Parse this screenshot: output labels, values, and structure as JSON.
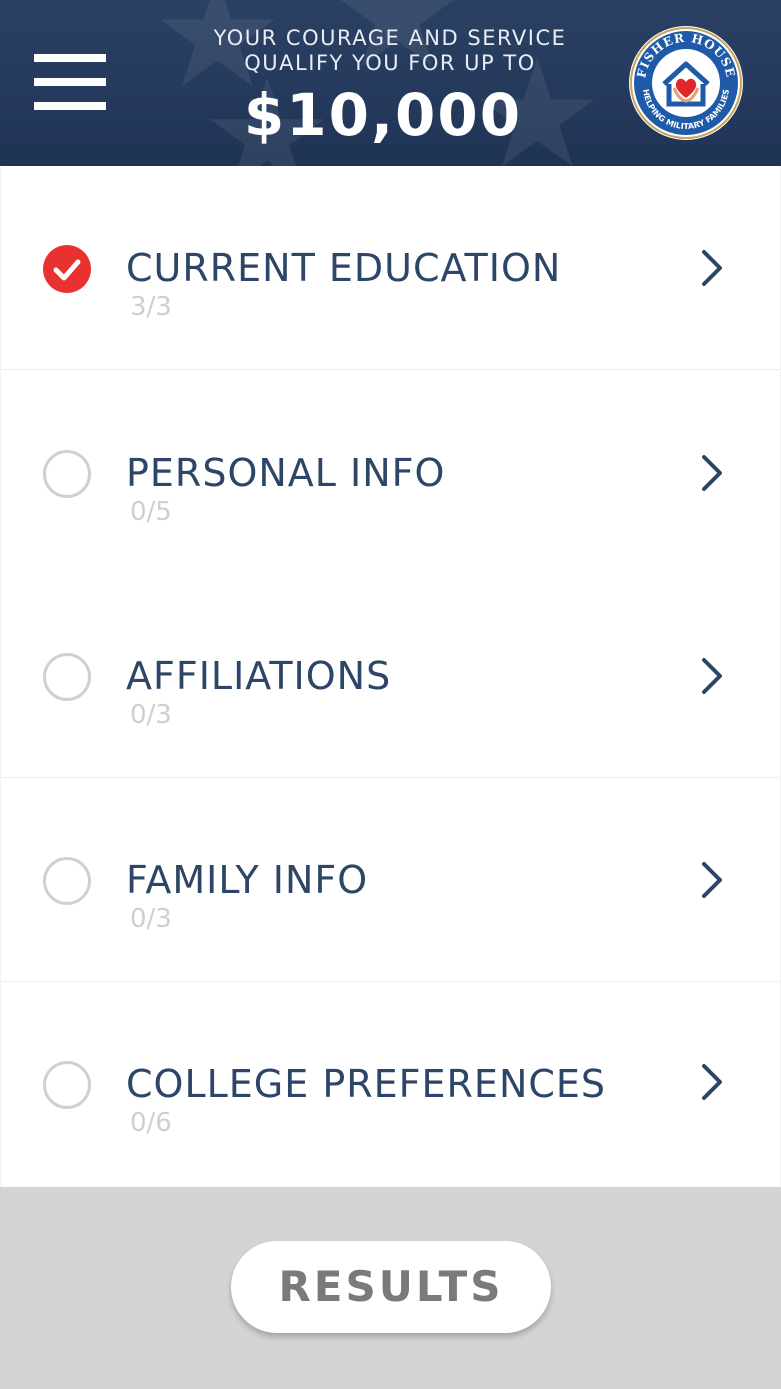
{
  "header": {
    "tagline_line1": "YOUR COURAGE AND SERVICE",
    "tagline_line2": "QUALIFY YOU FOR UP TO",
    "amount": "$10,000",
    "logo": {
      "top_text": "FISHER HOUSE",
      "bottom_text": "HELPING MILITARY FAMILIES",
      "icon": "house-heart-hands-icon"
    },
    "menu_icon": "hamburger-menu-icon"
  },
  "sections": [
    {
      "label": "CURRENT EDUCATION",
      "count": "3/3",
      "complete": true
    },
    {
      "label": "PERSONAL INFO",
      "count": "0/5",
      "complete": false
    },
    {
      "label": "AFFILIATIONS",
      "count": "0/3",
      "complete": false
    },
    {
      "label": "FAMILY INFO",
      "count": "0/3",
      "complete": false
    },
    {
      "label": "COLLEGE PREFERENCES",
      "count": "0/6",
      "complete": false
    }
  ],
  "footer": {
    "results_label": "RESULTS"
  },
  "colors": {
    "header_bg": "#24395b",
    "label_text": "#2d4667",
    "count_text": "#cfcfcf",
    "check_red": "#e8322f",
    "footer_bg": "#d4d4d4",
    "button_text": "#7a7a7a"
  }
}
